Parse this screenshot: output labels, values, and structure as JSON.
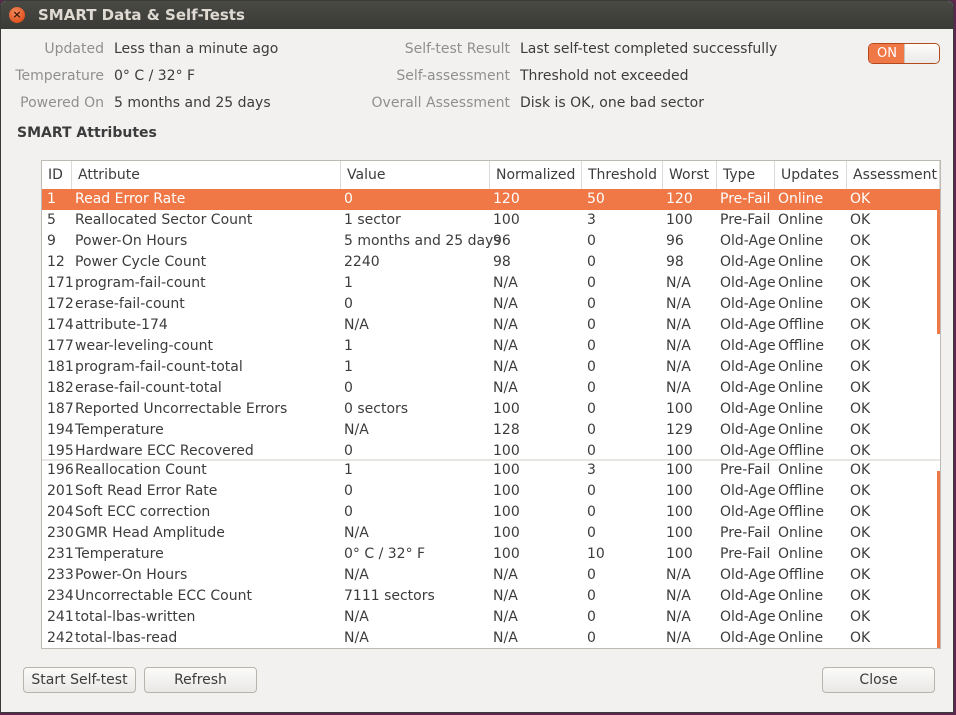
{
  "window": {
    "title": "SMART Data & Self-Tests",
    "close_glyph": "×"
  },
  "info_left": [
    {
      "label": "Updated",
      "value": "Less than a minute ago"
    },
    {
      "label": "Temperature",
      "value": "0° C / 32° F"
    },
    {
      "label": "Powered On",
      "value": "5 months and 25 days"
    }
  ],
  "info_right": [
    {
      "label": "Self-test Result",
      "value": "Last self-test completed successfully"
    },
    {
      "label": "Self-assessment",
      "value": "Threshold not exceeded"
    },
    {
      "label": "Overall Assessment",
      "value": "Disk is OK, one bad sector"
    }
  ],
  "smart_toggle": {
    "label": "ON",
    "state": "on"
  },
  "section_title": "SMART Attributes",
  "table": {
    "columns": [
      "ID",
      "Attribute",
      "Value",
      "Normalized",
      "Threshold",
      "Worst",
      "Type",
      "Updates",
      "Assessment"
    ],
    "rows": [
      [
        "1",
        "Read Error Rate",
        "0",
        "120",
        "50",
        "120",
        "Pre-Fail",
        "Online",
        "OK"
      ],
      [
        "5",
        "Reallocated Sector Count",
        "1 sector",
        "100",
        "3",
        "100",
        "Pre-Fail",
        "Online",
        "OK"
      ],
      [
        "9",
        "Power-On Hours",
        "5 months and 25 days",
        "96",
        "0",
        "96",
        "Old-Age",
        "Online",
        "OK"
      ],
      [
        "12",
        "Power Cycle Count",
        "2240",
        "98",
        "0",
        "98",
        "Old-Age",
        "Online",
        "OK"
      ],
      [
        "171",
        "program-fail-count",
        "1",
        "N/A",
        "0",
        "N/A",
        "Old-Age",
        "Online",
        "OK"
      ],
      [
        "172",
        "erase-fail-count",
        "0",
        "N/A",
        "0",
        "N/A",
        "Old-Age",
        "Online",
        "OK"
      ],
      [
        "174",
        "attribute-174",
        "N/A",
        "N/A",
        "0",
        "N/A",
        "Old-Age",
        "Offline",
        "OK"
      ],
      [
        "177",
        "wear-leveling-count",
        "1",
        "N/A",
        "0",
        "N/A",
        "Old-Age",
        "Offline",
        "OK"
      ],
      [
        "181",
        "program-fail-count-total",
        "1",
        "N/A",
        "0",
        "N/A",
        "Old-Age",
        "Online",
        "OK"
      ],
      [
        "182",
        "erase-fail-count-total",
        "0",
        "N/A",
        "0",
        "N/A",
        "Old-Age",
        "Online",
        "OK"
      ],
      [
        "187",
        "Reported Uncorrectable Errors",
        "0 sectors",
        "100",
        "0",
        "100",
        "Old-Age",
        "Online",
        "OK"
      ],
      [
        "194",
        "Temperature",
        "N/A",
        "128",
        "0",
        "129",
        "Old-Age",
        "Online",
        "OK"
      ],
      [
        "195",
        "Hardware ECC Recovered",
        "0",
        "100",
        "0",
        "100",
        "Old-Age",
        "Offline",
        "OK"
      ],
      [
        "196",
        "Reallocation Count",
        "1",
        "100",
        "3",
        "100",
        "Pre-Fail",
        "Online",
        "OK"
      ],
      [
        "201",
        "Soft Read Error Rate",
        "0",
        "100",
        "0",
        "100",
        "Old-Age",
        "Offline",
        "OK"
      ],
      [
        "204",
        "Soft ECC correction",
        "0",
        "100",
        "0",
        "100",
        "Old-Age",
        "Offline",
        "OK"
      ],
      [
        "230",
        "GMR Head Amplitude",
        "N/A",
        "100",
        "0",
        "100",
        "Pre-Fail",
        "Online",
        "OK"
      ],
      [
        "231",
        "Temperature",
        "0° C / 32° F",
        "100",
        "10",
        "100",
        "Pre-Fail",
        "Online",
        "OK"
      ],
      [
        "233",
        "Power-On Hours",
        "N/A",
        "N/A",
        "0",
        "N/A",
        "Old-Age",
        "Offline",
        "OK"
      ],
      [
        "234",
        "Uncorrectable ECC Count",
        "7111 sectors",
        "N/A",
        "0",
        "N/A",
        "Old-Age",
        "Online",
        "OK"
      ],
      [
        "241",
        "total-lbas-written",
        "N/A",
        "N/A",
        "0",
        "N/A",
        "Old-Age",
        "Online",
        "OK"
      ],
      [
        "242",
        "total-lbas-read",
        "N/A",
        "N/A",
        "0",
        "N/A",
        "Old-Age",
        "Online",
        "OK"
      ]
    ],
    "selected_row": 0
  },
  "buttons": {
    "start_self_test": "Start Self-test",
    "refresh": "Refresh",
    "close": "Close"
  },
  "colors": {
    "accent": "#f07746",
    "window_bg": "#f2f1f0",
    "titlebar": "#3c3b37"
  }
}
